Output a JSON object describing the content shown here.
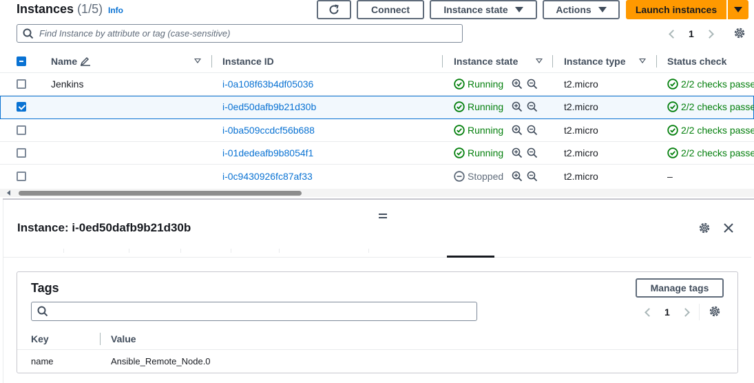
{
  "header": {
    "title": "Instances",
    "count": "(1/5)",
    "info": "Info",
    "connect_label": "Connect",
    "instance_state_label": "Instance state",
    "actions_label": "Actions",
    "launch_label": "Launch instances",
    "search_placeholder": "Find Instance by attribute or tag (case-sensitive)",
    "page": "1"
  },
  "table": {
    "columns": [
      "Name",
      "Instance ID",
      "Instance state",
      "Instance type",
      "Status check"
    ],
    "rows": [
      {
        "name": "Jenkins",
        "id": "i-0a108f63b4df05036",
        "state": "Running",
        "type": "t2.micro",
        "status": "2/2 checks passe",
        "selected": false
      },
      {
        "name": "",
        "id": "i-0ed50dafb9b21d30b",
        "state": "Running",
        "type": "t2.micro",
        "status": "2/2 checks passe",
        "selected": true
      },
      {
        "name": "",
        "id": "i-0ba509ccdcf56b688",
        "state": "Running",
        "type": "t2.micro",
        "status": "2/2 checks passe",
        "selected": false
      },
      {
        "name": "",
        "id": "i-01dedeafb9b8054f1",
        "state": "Running",
        "type": "t2.micro",
        "status": "2/2 checks passe",
        "selected": false
      },
      {
        "name": "",
        "id": "i-0c9430926fc87af33",
        "state": "Stopped",
        "type": "t2.micro",
        "status": "–",
        "selected": false
      }
    ]
  },
  "details": {
    "title": "Instance: i-0ed50dafb9b21d30b",
    "tags": {
      "title": "Tags",
      "manage_label": "Manage tags",
      "search_placeholder": "",
      "page": "1",
      "columns": [
        "Key",
        "Value"
      ],
      "rows": [
        {
          "key": "name",
          "value": "Ansible_Remote_Node.0"
        }
      ]
    }
  },
  "colors": {
    "accent": "#0972d3",
    "primary_button": "#ff9900",
    "running": "#037f0c",
    "stopped": "#5f6b7a"
  },
  "icons": [
    "refresh-icon",
    "search-icon",
    "gear-icon",
    "close-icon",
    "edit-icon",
    "zoom-in-icon",
    "zoom-out-icon",
    "status-ok-icon",
    "status-stopped-icon"
  ]
}
